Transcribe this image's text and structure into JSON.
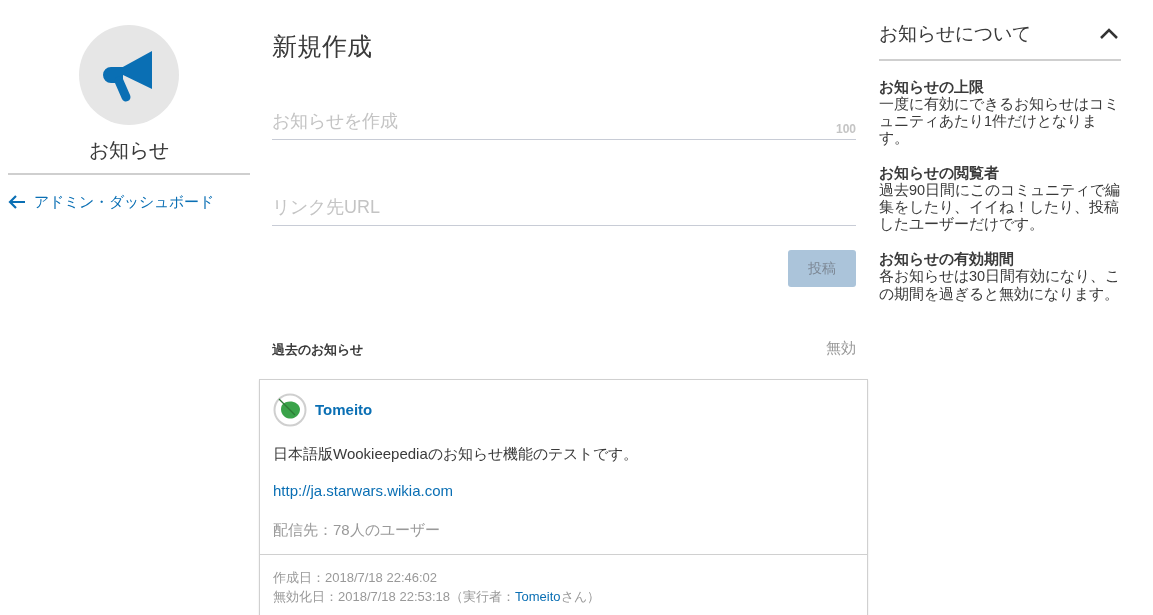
{
  "sidebar": {
    "title": "お知らせ",
    "back_link": "アドミン・ダッシュボード"
  },
  "main": {
    "heading": "新規作成",
    "message_field": {
      "placeholder": "お知らせを作成",
      "counter": "100"
    },
    "url_field": {
      "placeholder": "リンク先URL"
    },
    "post_button": {
      "label": "投稿",
      "disabled": true
    },
    "history": {
      "title": "過去のお知らせ",
      "status": "無効",
      "items": [
        {
          "author": "Tomeito",
          "message": "日本語版Wookieepediaのお知らせ機能のテストです。",
          "link": "http://ja.starwars.wikia.com",
          "audience": "配信先：78人のユーザー",
          "created": "作成日：2018/7/18 22:46:02",
          "disabled_prefix": "無効化日：2018/7/18 22:53:18（実行者：",
          "disabled_by": "Tomeito",
          "disabled_suffix": "さん）"
        }
      ]
    }
  },
  "info_panel": {
    "title": "お知らせについて",
    "expanded": true,
    "sections": [
      {
        "title": "お知らせの上限",
        "text": "一度に有効にできるお知らせはコミュニティあたり1件だけとなります。"
      },
      {
        "title": "お知らせの閲覧者",
        "text": "過去90日間にこのコミュニティで編集をしたり、イイね！したり、投稿したユーザーだけです。"
      },
      {
        "title": "お知らせの有効期間",
        "text": "各お知らせは30日間有効になり、この期間を過ぎると無効になります。"
      }
    ]
  }
}
